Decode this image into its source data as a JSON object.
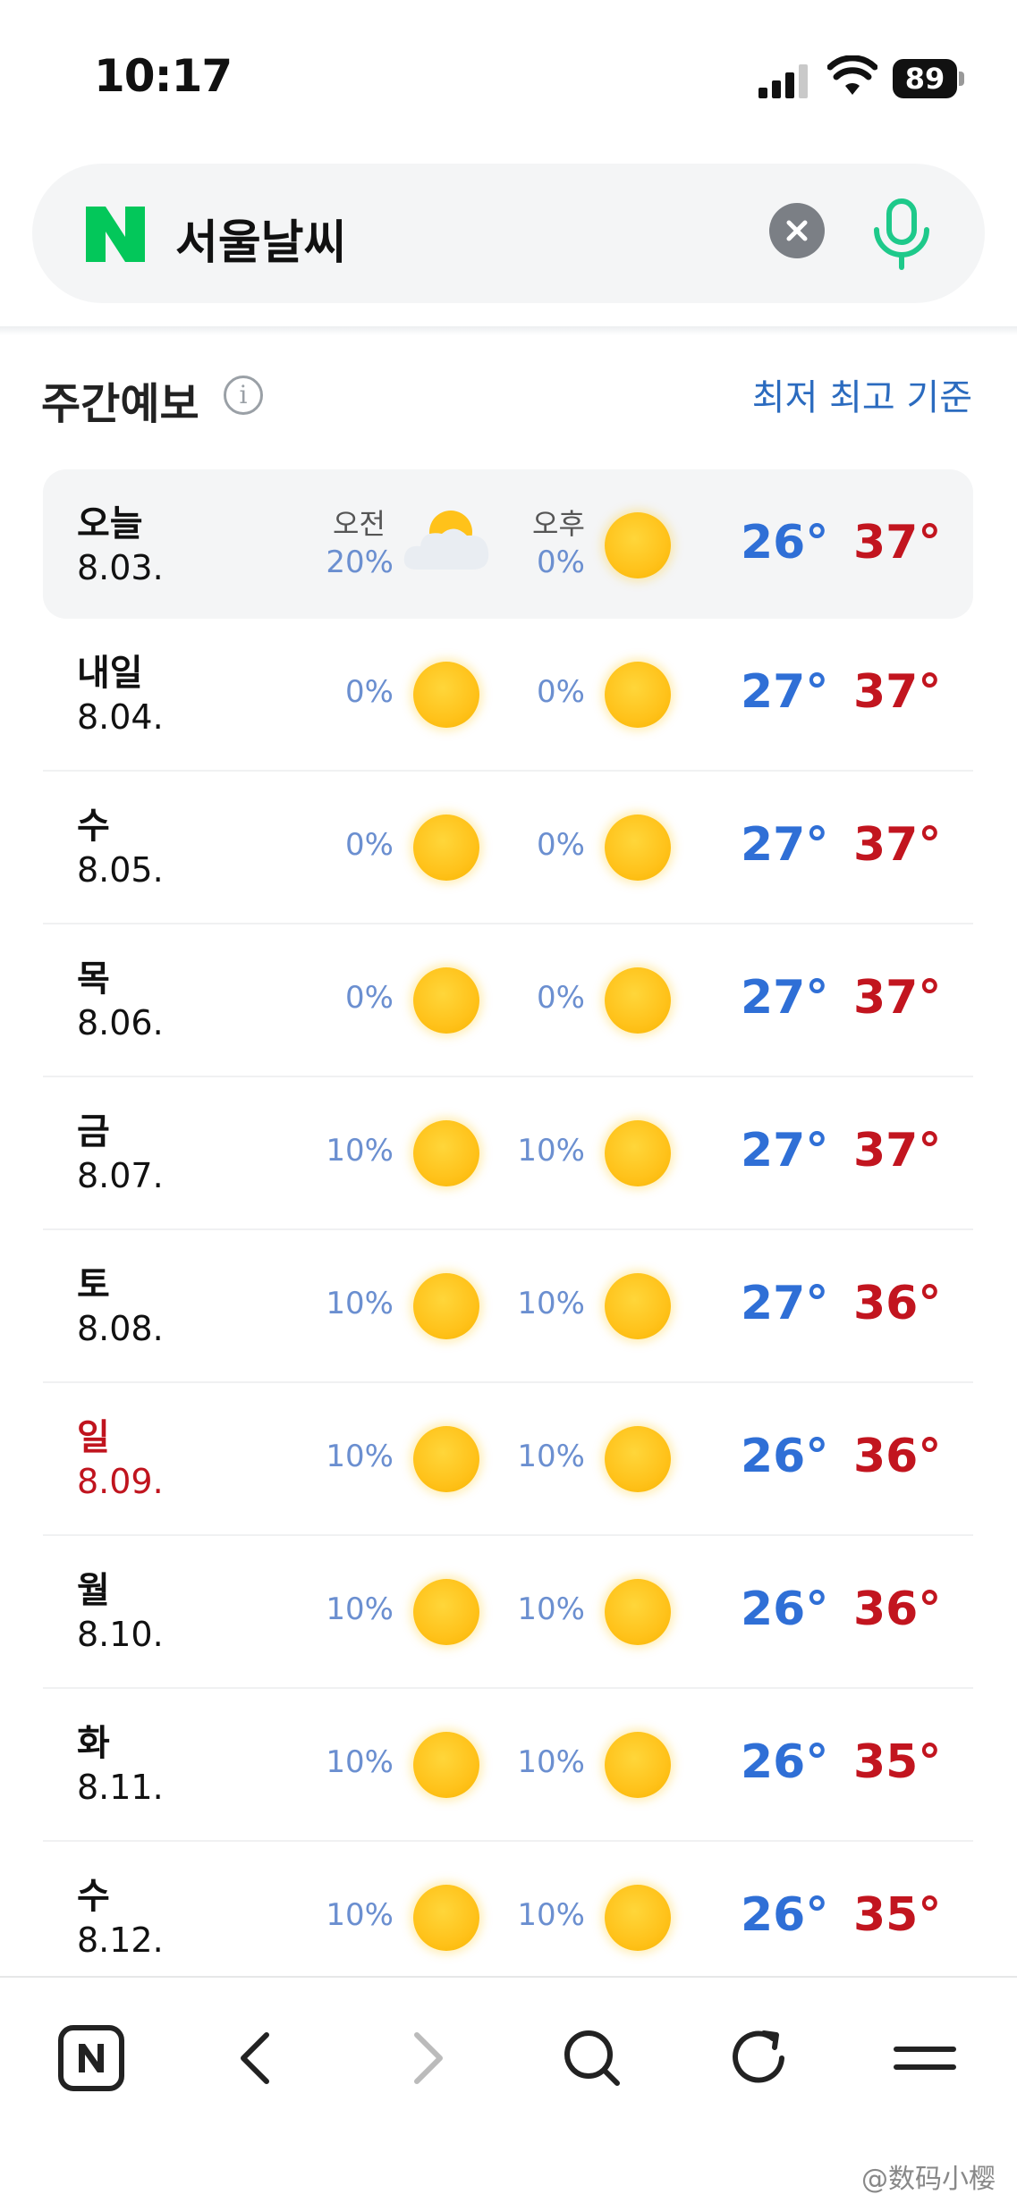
{
  "status_bar": {
    "time": "10:17",
    "battery": "89"
  },
  "search": {
    "query": "서울날씨",
    "logo": "N"
  },
  "section": {
    "title": "주간예보",
    "sort_link": "최저 최고 기준"
  },
  "labels": {
    "am": "오전",
    "pm": "오후"
  },
  "colors": {
    "low_temp": "#2f6fd6",
    "high_temp": "#c2151f",
    "holiday": "#c0141e",
    "brand_green": "#03c75a"
  },
  "forecast": [
    {
      "day": "오늘",
      "date": "8.03.",
      "am_rain": "20%",
      "am_icon": "partly-cloudy-icon",
      "pm_rain": "0%",
      "pm_icon": "sun-icon",
      "low": "26°",
      "high": "37°"
    },
    {
      "day": "내일",
      "date": "8.04.",
      "am_rain": "0%",
      "am_icon": "sun-icon",
      "pm_rain": "0%",
      "pm_icon": "sun-icon",
      "low": "27°",
      "high": "37°"
    },
    {
      "day": "수",
      "date": "8.05.",
      "am_rain": "0%",
      "am_icon": "sun-icon",
      "pm_rain": "0%",
      "pm_icon": "sun-icon",
      "low": "27°",
      "high": "37°"
    },
    {
      "day": "목",
      "date": "8.06.",
      "am_rain": "0%",
      "am_icon": "sun-icon",
      "pm_rain": "0%",
      "pm_icon": "sun-icon",
      "low": "27°",
      "high": "37°"
    },
    {
      "day": "금",
      "date": "8.07.",
      "am_rain": "10%",
      "am_icon": "sun-icon",
      "pm_rain": "10%",
      "pm_icon": "sun-icon",
      "low": "27°",
      "high": "37°"
    },
    {
      "day": "토",
      "date": "8.08.",
      "am_rain": "10%",
      "am_icon": "sun-icon",
      "pm_rain": "10%",
      "pm_icon": "sun-icon",
      "low": "27°",
      "high": "36°"
    },
    {
      "day": "일",
      "date": "8.09.",
      "am_rain": "10%",
      "am_icon": "sun-icon",
      "pm_rain": "10%",
      "pm_icon": "sun-icon",
      "low": "26°",
      "high": "36°",
      "holiday": true
    },
    {
      "day": "월",
      "date": "8.10.",
      "am_rain": "10%",
      "am_icon": "sun-icon",
      "pm_rain": "10%",
      "pm_icon": "sun-icon",
      "low": "26°",
      "high": "36°"
    },
    {
      "day": "화",
      "date": "8.11.",
      "am_rain": "10%",
      "am_icon": "sun-icon",
      "pm_rain": "10%",
      "pm_icon": "sun-icon",
      "low": "26°",
      "high": "35°"
    },
    {
      "day": "수",
      "date": "8.12.",
      "am_rain": "10%",
      "am_icon": "sun-icon",
      "pm_rain": "10%",
      "pm_icon": "sun-icon",
      "low": "26°",
      "high": "35°"
    }
  ],
  "bottom_nav": [
    "naver-home-icon",
    "back-icon",
    "forward-icon",
    "search-icon",
    "refresh-icon",
    "menu-icon"
  ],
  "watermark": "@数码小樱"
}
